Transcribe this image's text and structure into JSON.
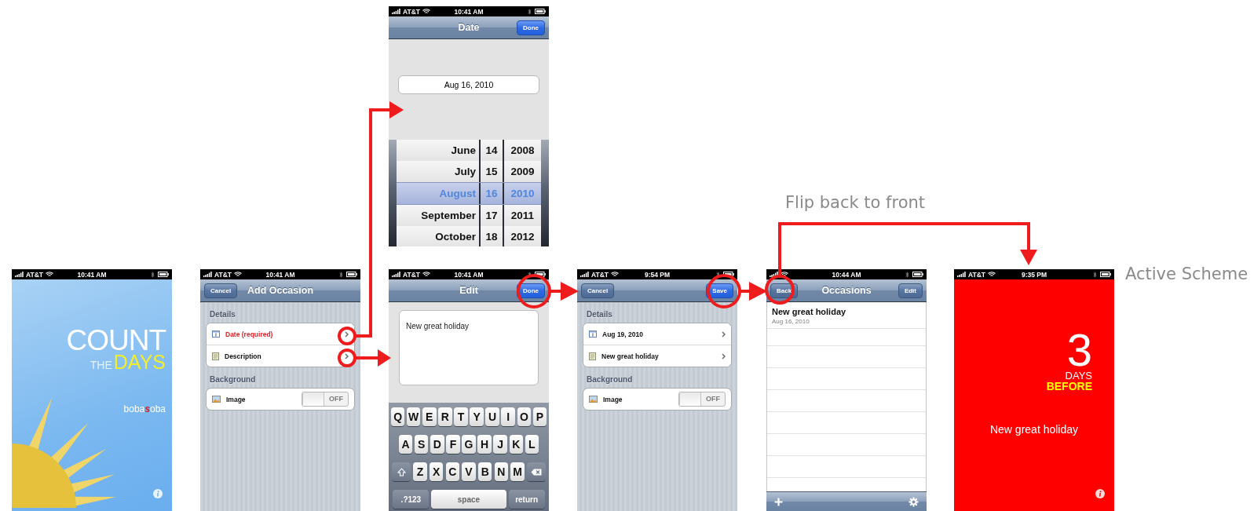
{
  "screens": [
    {
      "kind": "splash",
      "status_bar": {
        "carrier": "AT&T",
        "time": "10:41 AM"
      },
      "logo": {
        "count": "COUNT",
        "the": "THE",
        "days": "DAYS"
      },
      "brand": [
        "boba",
        "s",
        "oba"
      ]
    },
    {
      "kind": "form",
      "status_bar": {
        "carrier": "AT&T",
        "time": "10:41 AM"
      },
      "nav": {
        "left": {
          "label": "Cancel",
          "kind": "plain"
        },
        "title": "Add Occasion"
      },
      "sections": [
        {
          "header": "Details",
          "rows": [
            {
              "kind": "link",
              "label": "Date (required)",
              "required": true
            },
            {
              "kind": "link",
              "label": "Description",
              "required": false
            }
          ]
        },
        {
          "header": "Background",
          "rows": [
            {
              "kind": "switch",
              "label": "Image",
              "switch_text": "OFF",
              "on": false
            }
          ]
        }
      ]
    },
    {
      "kind": "date_picker",
      "status_bar": {
        "carrier": "AT&T",
        "time": "10:41 AM"
      },
      "nav": {
        "title": "Date",
        "right": {
          "label": "Done",
          "kind": "primary"
        }
      },
      "field_value": "Aug 16, 2010",
      "wheel": [
        {
          "month": "June",
          "day": "14",
          "year": "2008",
          "selected": false
        },
        {
          "month": "July",
          "day": "15",
          "year": "2009",
          "selected": false
        },
        {
          "month": "August",
          "day": "16",
          "year": "2010",
          "selected": true
        },
        {
          "month": "September",
          "day": "17",
          "year": "2011",
          "selected": false
        },
        {
          "month": "October",
          "day": "18",
          "year": "2012",
          "selected": false
        }
      ]
    },
    {
      "kind": "editor",
      "status_bar": {
        "carrier": "AT&T",
        "time": "10:41 AM"
      },
      "nav": {
        "title": "Edit",
        "right": {
          "label": "Done",
          "kind": "primary"
        }
      },
      "text": "New great holiday",
      "keyboard": [
        [
          {
            "kind": "letter",
            "label": "Q"
          },
          {
            "kind": "letter",
            "label": "W"
          },
          {
            "kind": "letter",
            "label": "E"
          },
          {
            "kind": "letter",
            "label": "R"
          },
          {
            "kind": "letter",
            "label": "T"
          },
          {
            "kind": "letter",
            "label": "Y"
          },
          {
            "kind": "letter",
            "label": "U"
          },
          {
            "kind": "letter",
            "label": "I"
          },
          {
            "kind": "letter",
            "label": "O"
          },
          {
            "kind": "letter",
            "label": "P"
          }
        ],
        [
          {
            "kind": "letter",
            "label": "A"
          },
          {
            "kind": "letter",
            "label": "S"
          },
          {
            "kind": "letter",
            "label": "D"
          },
          {
            "kind": "letter",
            "label": "F"
          },
          {
            "kind": "letter",
            "label": "G"
          },
          {
            "kind": "letter",
            "label": "H"
          },
          {
            "kind": "letter",
            "label": "J"
          },
          {
            "kind": "letter",
            "label": "K"
          },
          {
            "kind": "letter",
            "label": "L"
          }
        ],
        [
          {
            "kind": "shift"
          },
          {
            "kind": "letter",
            "label": "Z"
          },
          {
            "kind": "letter",
            "label": "X"
          },
          {
            "kind": "letter",
            "label": "C"
          },
          {
            "kind": "letter",
            "label": "V"
          },
          {
            "kind": "letter",
            "label": "B"
          },
          {
            "kind": "letter",
            "label": "N"
          },
          {
            "kind": "letter",
            "label": "M"
          },
          {
            "kind": "delete"
          }
        ],
        [
          {
            "kind": "mode",
            "label": ".?123"
          },
          {
            "kind": "space",
            "label": "space"
          },
          {
            "kind": "return",
            "label": "return"
          }
        ]
      ]
    },
    {
      "kind": "form",
      "status_bar": {
        "carrier": "AT&T",
        "time": "9:54 PM"
      },
      "nav": {
        "left": {
          "label": "Cancel",
          "kind": "plain"
        },
        "right": {
          "label": "Save",
          "kind": "primary"
        }
      },
      "sections": [
        {
          "header": "Details",
          "rows": [
            {
              "kind": "link",
              "label": "Aug 19, 2010",
              "required": false
            },
            {
              "kind": "link",
              "label": "New great holiday",
              "required": false
            }
          ]
        },
        {
          "header": "Background",
          "rows": [
            {
              "kind": "switch",
              "label": "Image",
              "switch_text": "OFF",
              "on": false
            }
          ]
        }
      ]
    },
    {
      "kind": "list",
      "status_bar": {
        "time": "10:44 AM"
      },
      "nav": {
        "left": {
          "label": "Back",
          "kind": "plain"
        },
        "title": "Occasions",
        "right": {
          "label": "Edit",
          "kind": "plain"
        }
      },
      "items": [
        {
          "title": "New great holiday",
          "subtitle": "Aug 16, 2010"
        }
      ]
    },
    {
      "kind": "countdown",
      "status_bar": {
        "carrier": "AT&T",
        "time": "9:35 PM"
      },
      "count": "3",
      "unit": "DAYS",
      "relation": "BEFORE",
      "name": "New great holiday"
    }
  ],
  "annotations": [
    "Flip back to front",
    "Active Scheme"
  ]
}
